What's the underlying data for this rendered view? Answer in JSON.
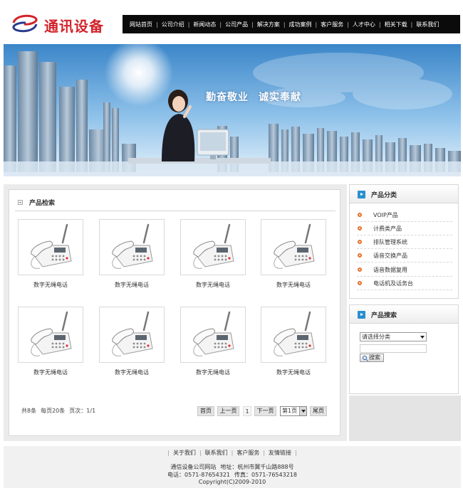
{
  "brand": {
    "name": "通讯设备"
  },
  "nav": {
    "items": [
      "网站首页",
      "公司介绍",
      "新闻动态",
      "公司产品",
      "解决方案",
      "成功案例",
      "客户服务",
      "人才中心",
      "相关下载",
      "联系我们"
    ]
  },
  "banner": {
    "slogan_part1": "勤奋敬业",
    "slogan_part2": "诚实奉献"
  },
  "products": {
    "title": "产品检索",
    "items": [
      {
        "name": "数字无绳电话"
      },
      {
        "name": "数字无绳电话"
      },
      {
        "name": "数字无绳电话"
      },
      {
        "name": "数字无绳电话"
      },
      {
        "name": "数字无绳电话"
      },
      {
        "name": "数字无绳电话"
      },
      {
        "name": "数字无绳电话"
      },
      {
        "name": "数字无绳电话"
      }
    ]
  },
  "pager": {
    "total": "共8条",
    "per_page": "每页20条",
    "page_info": "页次：1/1",
    "first": "首页",
    "prev": "上一页",
    "current": "1",
    "next": "下一页",
    "select_value": "第1页",
    "last": "尾页"
  },
  "categories": {
    "title": "产品分类",
    "items": [
      "VOIP产品",
      "计费类产品",
      "排队管理系统",
      "语音交换产品",
      "语音数据复用",
      "电话机及话务台"
    ]
  },
  "search": {
    "title": "产品搜索",
    "select_value": "请选择分类",
    "input_value": "",
    "button_label": "搜索"
  },
  "footer": {
    "links": [
      "关于我们",
      "联系我们",
      "客户服务",
      "友情链接"
    ],
    "site": "通信设备公司网站",
    "address": "地址：杭州市翼千山路888号",
    "phone": "电话：0571-87654321",
    "fax": "传真：0571-76543218",
    "copyright": "Copyright(C)2009-2010"
  },
  "colors": {
    "brand_red": "#d2232a",
    "nav_bg": "#0b0b0b",
    "accent_blue": "#2a8fd0",
    "bullet_orange": "#e8702a"
  }
}
